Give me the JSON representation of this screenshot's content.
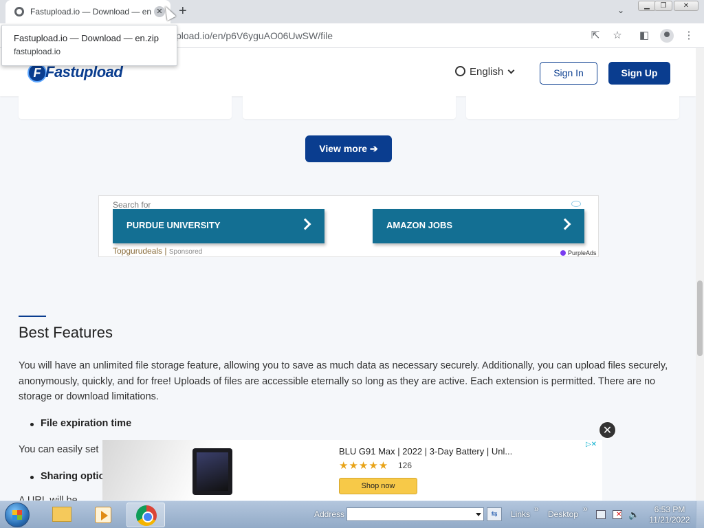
{
  "browser": {
    "tab_title": "Fastupload.io — Download — en.zip",
    "tab_close": "✕",
    "new_tab": "+",
    "url": "pload.io/en/p6V6yguAO06UwSW/file",
    "tooltip": {
      "title": "Fastupload.io — Download — en.zip",
      "domain": "fastupload.io"
    },
    "window_buttons": {
      "minimize": "▁",
      "restore": "❐",
      "close": "✕"
    }
  },
  "site": {
    "logo_text": "Fastupload",
    "language": "English",
    "sign_in": "Sign In",
    "sign_up": "Sign Up",
    "view_more": "View more ➔"
  },
  "ad_top": {
    "search_for": "Search for",
    "buttons": [
      "PURDUE UNIVERSITY",
      "AMAZON JOBS"
    ],
    "brand": "Topgurudeals",
    "sponsored": "Sponsored",
    "network": "PurpleAds"
  },
  "content": {
    "heading": "Best Features",
    "paragraph": "You will have an unlimited file storage feature, allowing you to save as much data as necessary securely. Additionally, you can upload files securely, anonymously, quickly, and for free! Uploads of files are accessible eternally so long as they are active. Each extension is permitted. There are no storage or download limitations.",
    "bullet1": "File expiration time",
    "line2": "You can easily set",
    "bullet2": "Sharing optio",
    "clipped": "A URL will be"
  },
  "ad_bottom": {
    "title": "BLU G91 Max | 2022 | 3-Day Battery | Unl...",
    "stars": "★★★★★",
    "rating": 4.5,
    "review_count": "126",
    "cta": "Shop now",
    "adchoices": "▷✕",
    "close": "✕"
  },
  "taskbar": {
    "address_label": "Address",
    "links_label": "Links",
    "desktop_label": "Desktop",
    "chevron": "»",
    "time": "6:53 PM",
    "date": "11/21/2022"
  },
  "colors": {
    "brand_blue": "#0a3d8f",
    "ad_button": "#136f93",
    "star": "#e8a317"
  }
}
